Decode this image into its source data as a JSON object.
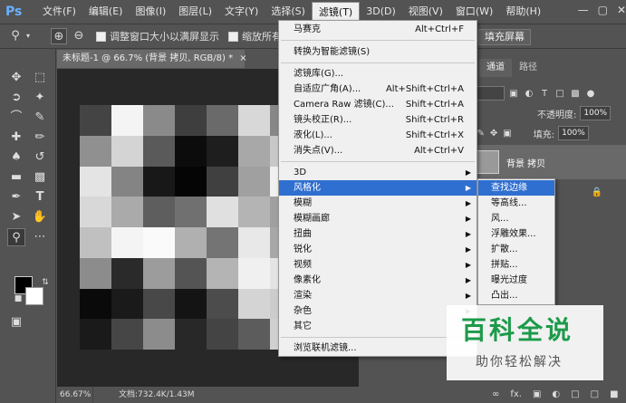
{
  "app": {
    "logo": "Ps"
  },
  "menubar": {
    "items": [
      {
        "label": "文件(F)"
      },
      {
        "label": "编辑(E)"
      },
      {
        "label": "图像(I)"
      },
      {
        "label": "图层(L)"
      },
      {
        "label": "文字(Y)"
      },
      {
        "label": "选择(S)"
      },
      {
        "label": "滤镜(T)"
      },
      {
        "label": "3D(D)"
      },
      {
        "label": "视图(V)"
      },
      {
        "label": "窗口(W)"
      },
      {
        "label": "帮助(H)"
      }
    ],
    "window_buttons": [
      "—",
      "▢",
      "✕"
    ]
  },
  "optionsbar": {
    "resize_windows_label": "调整窗口大小以满屏显示",
    "zoom_all_label": "缩放所有",
    "fill_screen_label": "填充屏幕"
  },
  "document": {
    "tab_title": "未标题-1 @ 66.7% (背景 拷贝, RGB/8) *",
    "tab_close": "×",
    "zoom": "66.67%",
    "doc_info": "文档:732.4K/1.43M",
    "pixels": [
      [
        "#444444",
        "#f4f4f4",
        "#8a8a8a",
        "#3e3e3e",
        "#6a6a6a",
        "#d8d8d8",
        "#888888"
      ],
      [
        "#909090",
        "#d4d4d4",
        "#5a5a5a",
        "#0c0c0c",
        "#1e1e1e",
        "#a8a8a8",
        "#c8c8c8"
      ],
      [
        "#e4e4e4",
        "#848484",
        "#181818",
        "#050505",
        "#404040",
        "#a0a0a0",
        "#f0f0f0"
      ],
      [
        "#d8d8d8",
        "#aaaaaa",
        "#5e5e5e",
        "#707070",
        "#e0e0e0",
        "#b4b4b4",
        "#a0a0a0"
      ],
      [
        "#c0c0c0",
        "#f4f4f4",
        "#fafafa",
        "#b0b0b0",
        "#747474",
        "#e8e8e8",
        "#a8a8a8"
      ],
      [
        "#8c8c8c",
        "#2a2a2a",
        "#9c9c9c",
        "#545454",
        "#b4b4b4",
        "#f0f0f0",
        "#e4e4e4"
      ],
      [
        "#0a0a0a",
        "#1a1a1a",
        "#484848",
        "#141414",
        "#4c4c4c",
        "#d4d4d4",
        "#cccccc"
      ],
      [
        "#1a1a1a",
        "#464646",
        "#8c8c8c",
        "#282828",
        "#444444",
        "#5c5c5c",
        "#d0d0d0"
      ]
    ]
  },
  "filter_menu": {
    "items": [
      {
        "label": "马赛克",
        "shortcut": "Alt+Ctrl+F"
      },
      {
        "label": "转换为智能滤镜(S)",
        "shortcut": ""
      },
      {
        "label": "滤镜库(G)...",
        "shortcut": ""
      },
      {
        "label": "自适应广角(A)...",
        "shortcut": "Alt+Shift+Ctrl+A"
      },
      {
        "label": "Camera Raw 滤镜(C)...",
        "shortcut": "Shift+Ctrl+A"
      },
      {
        "label": "镜头校正(R)...",
        "shortcut": "Shift+Ctrl+R"
      },
      {
        "label": "液化(L)...",
        "shortcut": "Shift+Ctrl+X"
      },
      {
        "label": "消失点(V)...",
        "shortcut": "Alt+Ctrl+V"
      },
      {
        "label": "3D",
        "shortcut": ""
      },
      {
        "label": "风格化",
        "shortcut": ""
      },
      {
        "label": "模糊",
        "shortcut": ""
      },
      {
        "label": "模糊画廊",
        "shortcut": ""
      },
      {
        "label": "扭曲",
        "shortcut": ""
      },
      {
        "label": "锐化",
        "shortcut": ""
      },
      {
        "label": "视频",
        "shortcut": ""
      },
      {
        "label": "像素化",
        "shortcut": ""
      },
      {
        "label": "渲染",
        "shortcut": ""
      },
      {
        "label": "杂色",
        "shortcut": ""
      },
      {
        "label": "其它",
        "shortcut": ""
      },
      {
        "label": "浏览联机滤镜...",
        "shortcut": ""
      }
    ]
  },
  "stylize_submenu": {
    "items": [
      {
        "label": "查找边缘"
      },
      {
        "label": "等高线..."
      },
      {
        "label": "风..."
      },
      {
        "label": "浮雕效果..."
      },
      {
        "label": "扩散..."
      },
      {
        "label": "拼贴..."
      },
      {
        "label": "曝光过度"
      },
      {
        "label": "凸出..."
      }
    ]
  },
  "layers_panel": {
    "tabs": [
      {
        "label": "通道"
      },
      {
        "label": "路径"
      }
    ],
    "opacity_label": "不透明度:",
    "opacity_value": "100%",
    "fill_label": "填充:",
    "fill_value": "100%",
    "layer_name": "背景 拷贝"
  },
  "watermark": {
    "title": "百科全说",
    "subtitle": "助你轻松解决"
  }
}
